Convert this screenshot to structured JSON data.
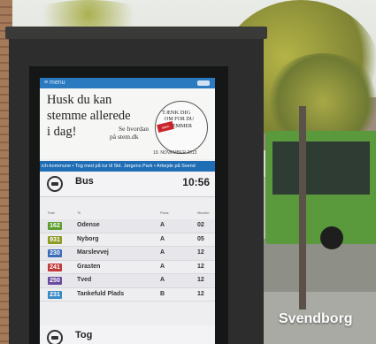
{
  "colors": {
    "header_blue": "#2b7ac0",
    "ticker_blue": "#1e6db5",
    "kiosk": "#2c2d2c",
    "bus_green": "#5a9a3c"
  },
  "screen": {
    "top_logo": "≡ menu",
    "ad": {
      "headline": [
        "Husk du kan",
        "stemme allerede",
        "i dag!"
      ],
      "link": [
        "Se hvordan",
        "på stem.dk"
      ],
      "badge": [
        "TÆNK DIG",
        "OM FOR DU",
        "STEMMER",
        ""
      ],
      "badge_stamp": "stem",
      "date": "19. NOVEMBER 2013"
    },
    "ticker": "ich-kommune  •  Tog med på tur til Skt. Jørgens Park  •  Arbejde på Svend",
    "bus_section": {
      "icon": "bus-icon",
      "title": "Bus",
      "time": "10:56"
    },
    "table_headers": {
      "route": "Rute",
      "destination": "Til",
      "platform": "Plads",
      "minutes": "Minutter"
    },
    "departures": [
      {
        "route": "162",
        "color": "#5c9e2e",
        "destination": "Odense",
        "platform": "A",
        "minutes": "02"
      },
      {
        "route": "931",
        "color": "#8f9b25",
        "destination": "Nyborg",
        "platform": "A",
        "minutes": "05"
      },
      {
        "route": "230",
        "color": "#3a6db8",
        "destination": "Marslevvej",
        "platform": "A",
        "minutes": "12"
      },
      {
        "route": "241",
        "color": "#c23a3a",
        "destination": "Grasten",
        "platform": "A",
        "minutes": "12"
      },
      {
        "route": "250",
        "color": "#6a4aa0",
        "destination": "Tved",
        "platform": "A",
        "minutes": "12"
      },
      {
        "route": "231",
        "color": "#3a8ac4",
        "destination": "Tankefuld Plads",
        "platform": "B",
        "minutes": "12"
      }
    ],
    "train_section": {
      "icon": "train-icon",
      "title": "Tog"
    }
  },
  "caption": "Svendborg"
}
